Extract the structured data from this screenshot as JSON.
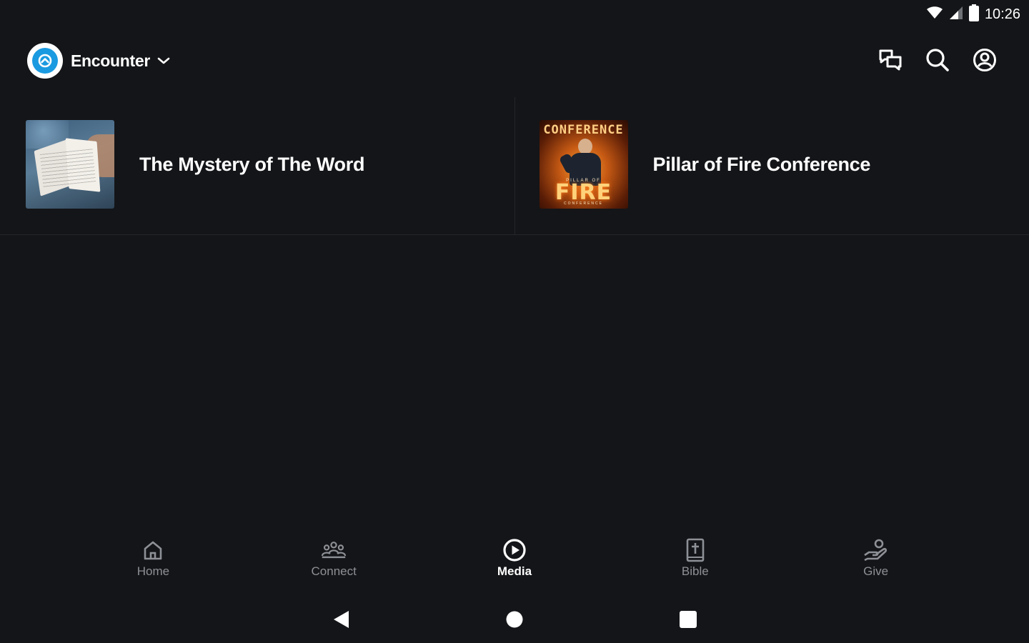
{
  "status_bar": {
    "time": "10:26",
    "icons": [
      "wifi-icon",
      "cell-signal-icon",
      "battery-icon"
    ]
  },
  "app_bar": {
    "church_name": "Encounter",
    "actions": [
      "chat-icon",
      "search-icon",
      "account-icon"
    ]
  },
  "media_items": [
    {
      "title": "The Mystery of The Word"
    },
    {
      "title": "Pillar of Fire Conference",
      "art_text": {
        "top": "CONFERENCE",
        "middle": "PILLAR OF",
        "main": "FIRE",
        "bottom": "CONFERENCE"
      }
    }
  ],
  "bottom_nav": [
    {
      "label": "Home",
      "icon": "home-icon",
      "active": false
    },
    {
      "label": "Connect",
      "icon": "people-icon",
      "active": false
    },
    {
      "label": "Media",
      "icon": "play-circle-icon",
      "active": true
    },
    {
      "label": "Bible",
      "icon": "bible-icon",
      "active": false
    },
    {
      "label": "Give",
      "icon": "give-hand-icon",
      "active": false
    }
  ],
  "system_nav": [
    "back-icon",
    "home-circle-icon",
    "recents-icon"
  ],
  "colors": {
    "background": "#141518",
    "accent": "#1a9ae0",
    "inactive": "#8d9096",
    "active": "#ffffff"
  }
}
